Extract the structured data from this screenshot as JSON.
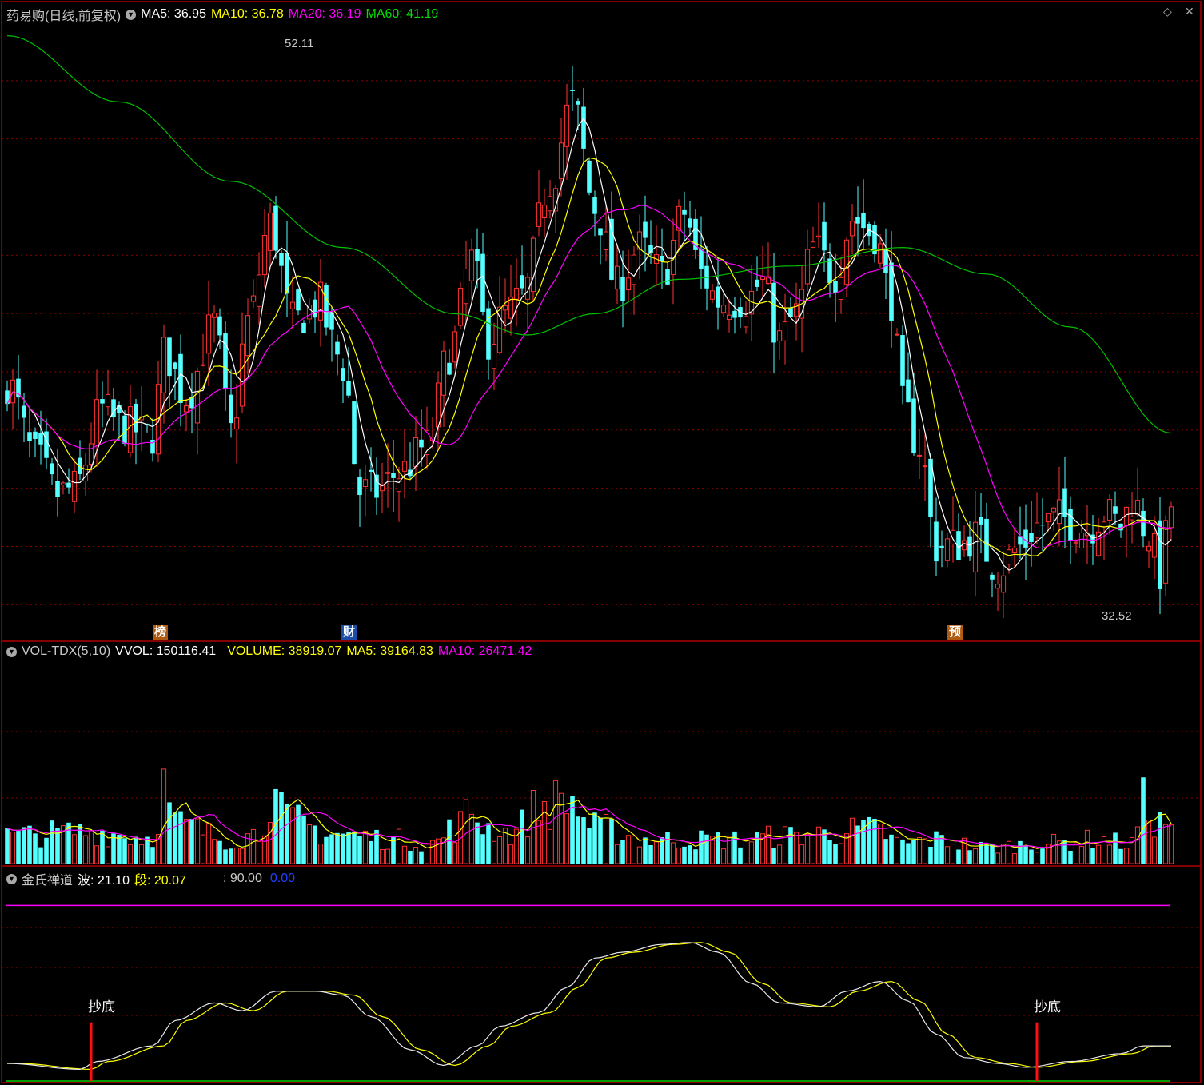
{
  "colors": {
    "up": "#ff3232",
    "down": "#54ffff",
    "ma5": "#ffffff",
    "ma10": "#ffff00",
    "ma20": "#ff00ff",
    "ma60": "#00c000",
    "grid": "#8b0000",
    "border": "#b00000"
  },
  "price_panel": {
    "stock_name": "药易购",
    "period_label": "(日线,前复权)",
    "ma5_label": "MA5:",
    "ma5_value": "36.95",
    "ma10_label": "MA10:",
    "ma10_value": "36.78",
    "ma20_label": "MA20:",
    "ma20_value": "36.19",
    "ma60_label": "MA60:",
    "ma60_value": "41.19",
    "high_annotation": "52.11",
    "low_annotation": "32.52",
    "event_tags": [
      {
        "text": "榜",
        "bar": 27
      },
      {
        "text": "财",
        "bar": 61
      },
      {
        "text": "预",
        "bar": 168
      }
    ]
  },
  "volume_panel": {
    "indicator": "VOL-TDX(5,10)",
    "vvol_label": "VVOL:",
    "vvol_value": "150116.41",
    "volume_label": "VOLUME:",
    "volume_value": "38919.07",
    "ma5_label": "MA5:",
    "ma5_value": "39164.83",
    "ma10_label": "MA10:",
    "ma10_value": "26471.42"
  },
  "indicator_panel": {
    "name": "金氏禅道",
    "wave_label": "波:",
    "wave_value": "21.10",
    "segment_label": "段:",
    "segment_value": "20.07",
    "level_value": ": 90.00",
    "zero_value": "0.00",
    "signal_text": "抄底",
    "signals": [
      15,
      184
    ]
  },
  "chart_data": {
    "type": "candlestick",
    "bars": 209,
    "price_range": [
      30.7,
      54.0
    ],
    "anchors_close": [
      [
        0,
        40.4
      ],
      [
        5,
        37.6
      ],
      [
        9,
        36.2
      ],
      [
        12,
        36.4
      ],
      [
        17,
        39.4
      ],
      [
        20,
        38.8
      ],
      [
        26,
        38.4
      ],
      [
        28,
        41.5
      ],
      [
        32,
        39.9
      ],
      [
        37,
        42.6
      ],
      [
        40,
        38.5
      ],
      [
        43,
        42.7
      ],
      [
        47,
        46.4
      ],
      [
        51,
        42.7
      ],
      [
        56,
        43.4
      ],
      [
        58,
        41.9
      ],
      [
        60,
        41.0
      ],
      [
        63,
        36.3
      ],
      [
        66,
        36.3
      ],
      [
        70,
        37.0
      ],
      [
        75,
        38.0
      ],
      [
        79,
        41.5
      ],
      [
        83,
        45.0
      ],
      [
        86,
        42.0
      ],
      [
        89,
        43.0
      ],
      [
        92,
        43.6
      ],
      [
        97,
        48.0
      ],
      [
        101,
        51.0
      ],
      [
        105,
        47.0
      ],
      [
        109,
        44.0
      ],
      [
        113,
        45.5
      ],
      [
        117,
        44.5
      ],
      [
        121,
        46.8
      ],
      [
        124,
        44.5
      ],
      [
        127,
        43.5
      ],
      [
        132,
        43.5
      ],
      [
        135,
        44.2
      ],
      [
        138,
        42.0
      ],
      [
        141,
        43.0
      ],
      [
        144,
        45.5
      ],
      [
        148,
        44.5
      ],
      [
        151,
        46.6
      ],
      [
        155,
        46.0
      ],
      [
        158,
        43.5
      ],
      [
        160,
        39.5
      ],
      [
        163,
        38.0
      ],
      [
        166,
        34.2
      ],
      [
        170,
        34.3
      ],
      [
        173,
        34.6
      ],
      [
        177,
        33.4
      ],
      [
        181,
        34.2
      ],
      [
        184,
        35.0
      ],
      [
        188,
        35.3
      ],
      [
        193,
        34.9
      ],
      [
        196,
        35.5
      ],
      [
        199,
        35.0
      ],
      [
        201,
        36.0
      ],
      [
        204,
        34.7
      ],
      [
        206,
        33.2
      ],
      [
        208,
        35.8
      ]
    ],
    "ma_labels": {
      "MA5": 36.95,
      "MA10": 36.78,
      "MA20": 36.19,
      "MA60": 41.19
    },
    "ma60_anchors": [
      [
        0,
        53.5
      ],
      [
        20,
        51.0
      ],
      [
        40,
        48.0
      ],
      [
        60,
        45.5
      ],
      [
        80,
        43.0
      ],
      [
        93,
        42.2
      ],
      [
        105,
        43.0
      ],
      [
        120,
        44.3
      ],
      [
        140,
        44.8
      ],
      [
        160,
        45.5
      ],
      [
        175,
        44.5
      ],
      [
        190,
        42.5
      ],
      [
        208,
        38.5
      ]
    ],
    "volume_anchors": [
      [
        0,
        0.14
      ],
      [
        14,
        0.16
      ],
      [
        26,
        0.13
      ],
      [
        28,
        0.38
      ],
      [
        30,
        0.2
      ],
      [
        40,
        0.12
      ],
      [
        45,
        0.15
      ],
      [
        47,
        0.35
      ],
      [
        50,
        0.22
      ],
      [
        58,
        0.15
      ],
      [
        70,
        0.12
      ],
      [
        76,
        0.1
      ],
      [
        80,
        0.18
      ],
      [
        83,
        0.26
      ],
      [
        86,
        0.18
      ],
      [
        90,
        0.15
      ],
      [
        95,
        0.28
      ],
      [
        100,
        0.32
      ],
      [
        105,
        0.18
      ],
      [
        115,
        0.12
      ],
      [
        130,
        0.12
      ],
      [
        140,
        0.14
      ],
      [
        145,
        0.15
      ],
      [
        155,
        0.17
      ],
      [
        160,
        0.1
      ],
      [
        166,
        0.12
      ],
      [
        175,
        0.08
      ],
      [
        185,
        0.1
      ],
      [
        195,
        0.12
      ],
      [
        201,
        0.1
      ],
      [
        203,
        0.3
      ],
      [
        206,
        0.2
      ],
      [
        208,
        0.22
      ]
    ],
    "wave_anchors": [
      [
        0,
        9
      ],
      [
        13,
        6
      ],
      [
        16,
        10
      ],
      [
        26,
        18
      ],
      [
        30,
        31
      ],
      [
        37,
        40
      ],
      [
        42,
        36
      ],
      [
        48,
        46
      ],
      [
        55,
        46
      ],
      [
        60,
        44
      ],
      [
        65,
        33
      ],
      [
        72,
        16
      ],
      [
        78,
        8
      ],
      [
        84,
        18
      ],
      [
        88,
        28
      ],
      [
        95,
        35
      ],
      [
        100,
        48
      ],
      [
        105,
        63
      ],
      [
        110,
        66
      ],
      [
        117,
        70
      ],
      [
        122,
        71
      ],
      [
        127,
        66
      ],
      [
        133,
        50
      ],
      [
        138,
        40
      ],
      [
        145,
        38
      ],
      [
        150,
        46
      ],
      [
        156,
        51
      ],
      [
        161,
        41
      ],
      [
        166,
        24
      ],
      [
        171,
        12
      ],
      [
        177,
        9
      ],
      [
        182,
        7
      ],
      [
        190,
        10
      ],
      [
        199,
        14
      ],
      [
        203,
        18
      ],
      [
        208,
        18
      ]
    ],
    "segment_offset_bars": 2,
    "volume_axis_max": 1.0,
    "indicator_range": [
      0,
      100
    ]
  }
}
